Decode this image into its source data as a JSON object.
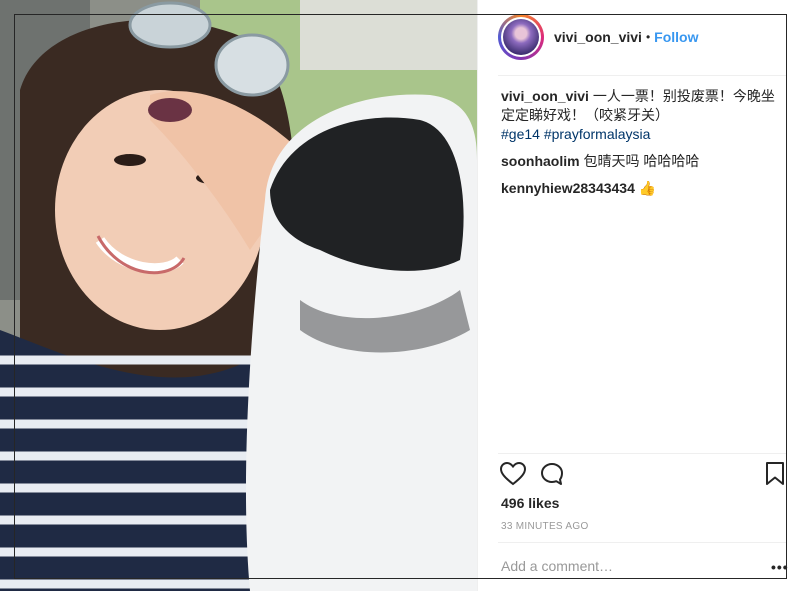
{
  "post": {
    "username": "vivi_oon_vivi",
    "separator": "•",
    "follow_label": "Follow"
  },
  "comments": [
    {
      "user": "vivi_oon_vivi",
      "text": "一人一票！别投废票！今晚坐定定睇好戏！（咬紧牙关）",
      "hashtags": "#ge14 #prayformalaysia"
    },
    {
      "user": "soonhaolim",
      "text": "包晴天吗 哈哈哈哈"
    },
    {
      "user": "kennyhiew28343434",
      "text": "👍"
    }
  ],
  "actions": {
    "like_icon": "heart-icon",
    "comment_icon": "comment-bubble-icon",
    "save_icon": "bookmark-icon"
  },
  "likes": "496 likes",
  "timestamp": "33 MINUTES AGO",
  "add_comment": {
    "placeholder": "Add a comment…",
    "more_label": "•••"
  },
  "colors": {
    "follow": "#3897f0",
    "hashtag": "#003569",
    "muted": "#999999",
    "text": "#262626"
  }
}
